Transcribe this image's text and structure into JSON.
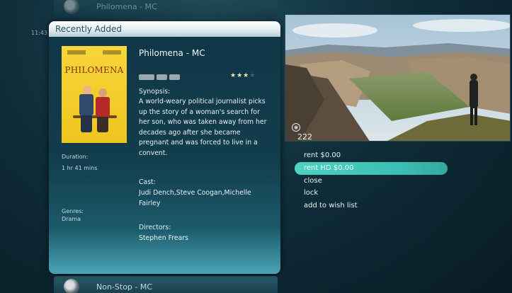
{
  "guide": {
    "top_channel": "Philomena - MC",
    "bottom_channel": "Non-Stop - MC",
    "time": "11:43"
  },
  "panel": {
    "header": "Recently Added",
    "poster_title": "PHILOMENA",
    "title": "Philomena - MC",
    "rating_stars": 3,
    "rating_max": 4,
    "synopsis_label": "Synopsis:",
    "synopsis": "A world-weary political journalist picks up the story of a woman's search for her son, who was taken away from her decades ago after she became pregnant and was forced to live in a convent.",
    "cast_label": "Cast:",
    "cast": "Judi Dench,Steve Coogan,Michelle Fairley",
    "directors_label": "Directors:",
    "directors": "Stephen Frears",
    "duration_label": "Duration:",
    "duration": "1 hr 41 mins",
    "genres_label": "Genres:",
    "genres": "Drama"
  },
  "preview": {
    "channel_number": "222"
  },
  "actions": [
    {
      "label": "rent $0.00",
      "selected": false
    },
    {
      "label": "rent HD $0.00",
      "selected": true
    },
    {
      "label": "close",
      "selected": false
    },
    {
      "label": "lock",
      "selected": false
    },
    {
      "label": "add to wish list",
      "selected": false
    }
  ],
  "colors": {
    "accent": "#3fc7b7",
    "panel_bg": "#123d4d",
    "header_bg": "#e6f1f5"
  },
  "icons": [
    "channel-logo-icon",
    "star-icon",
    "disc-icon"
  ]
}
